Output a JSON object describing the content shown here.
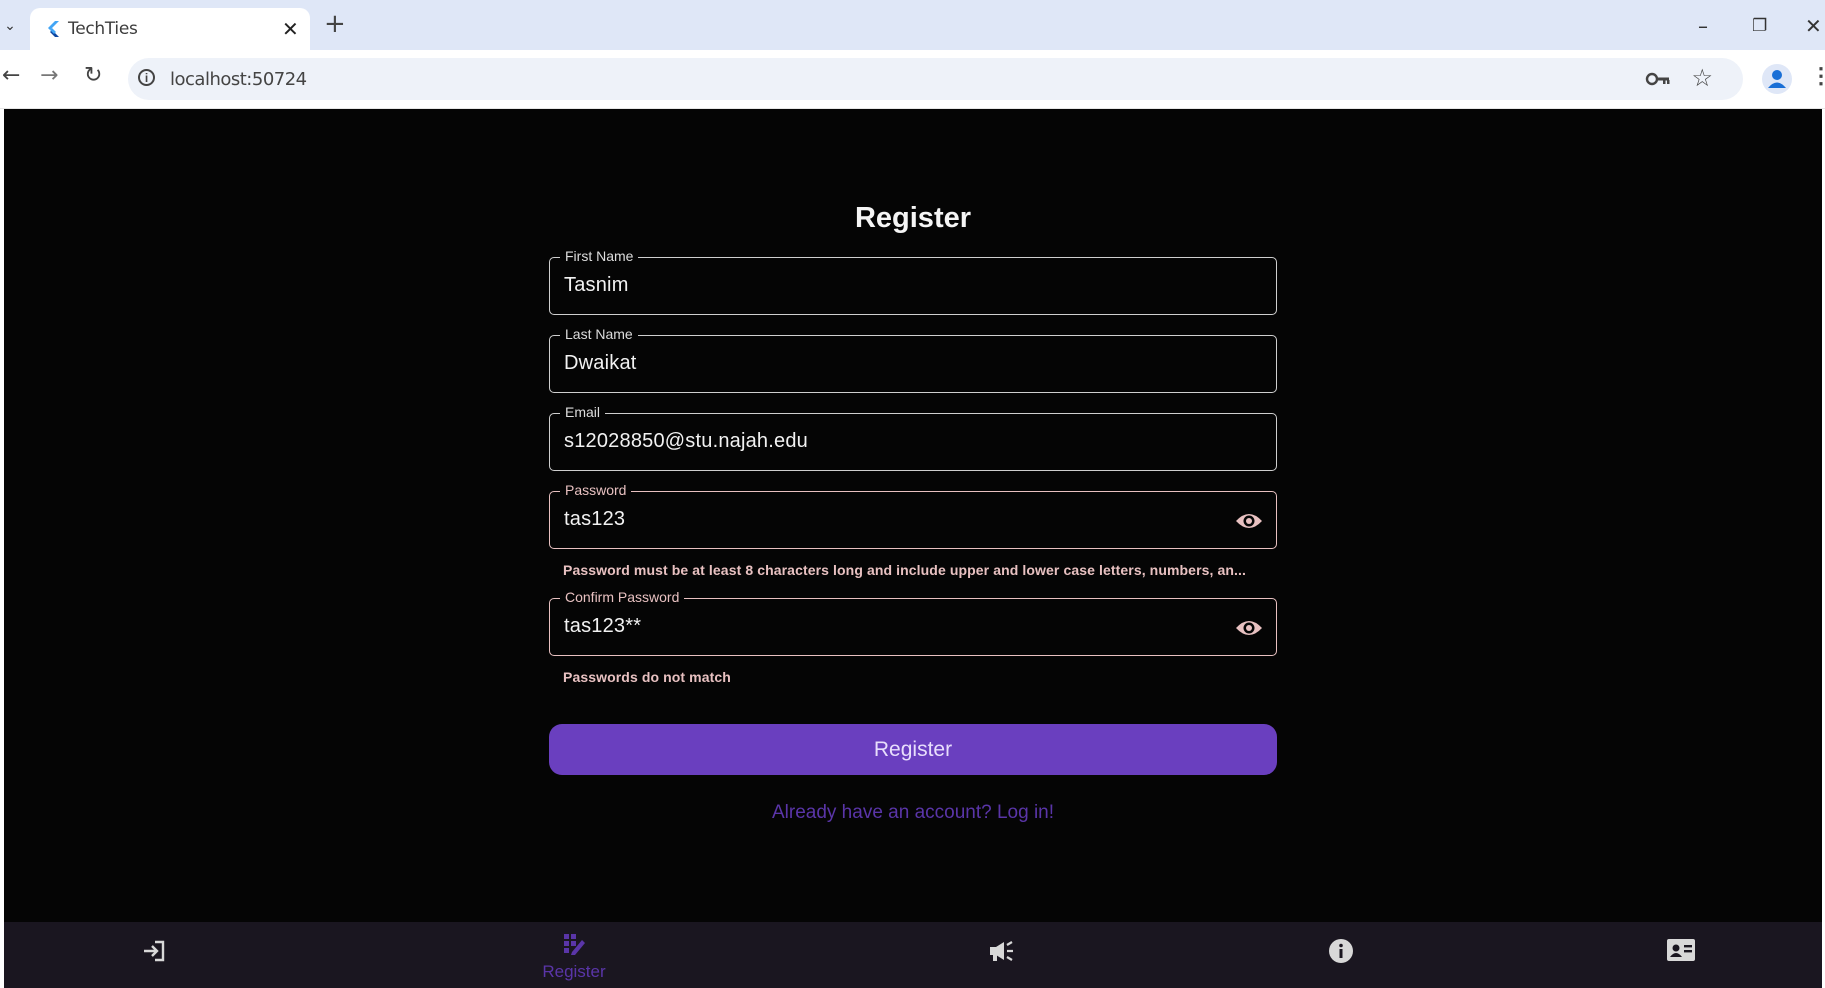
{
  "browser": {
    "tab_title": "TechTies",
    "tab_close": "✕",
    "new_tab": "+",
    "url": "localhost:50724",
    "window_controls": {
      "minimize": "–",
      "restore": "❐",
      "close": "✕"
    }
  },
  "form": {
    "title": "Register",
    "fields": {
      "first_name": {
        "label": "First Name",
        "value": "Tasnim"
      },
      "last_name": {
        "label": "Last Name",
        "value": "Dwaikat"
      },
      "email": {
        "label": "Email",
        "value": "s12028850@stu.najah.edu"
      },
      "password": {
        "label": "Password",
        "value": "tas123",
        "error": "Password must be at least 8 characters long and include upper and lower case letters, numbers, an..."
      },
      "confirm_password": {
        "label": "Confirm Password",
        "value": "tas123**",
        "error": "Passwords do not match"
      }
    },
    "submit_label": "Register",
    "login_link": "Already have an account? Log in!"
  },
  "bottom_nav": {
    "items": [
      {
        "icon": "login-icon",
        "label": ""
      },
      {
        "icon": "app-registration-icon",
        "label": "Register",
        "active": true
      },
      {
        "icon": "campaign-icon",
        "label": ""
      },
      {
        "icon": "info-icon",
        "label": ""
      },
      {
        "icon": "contact-card-icon",
        "label": ""
      }
    ]
  },
  "colors": {
    "app_background": "#050505",
    "accent": "#6a3fbf",
    "error": "#e8c1c1",
    "bottom_nav": "#1a1620"
  }
}
